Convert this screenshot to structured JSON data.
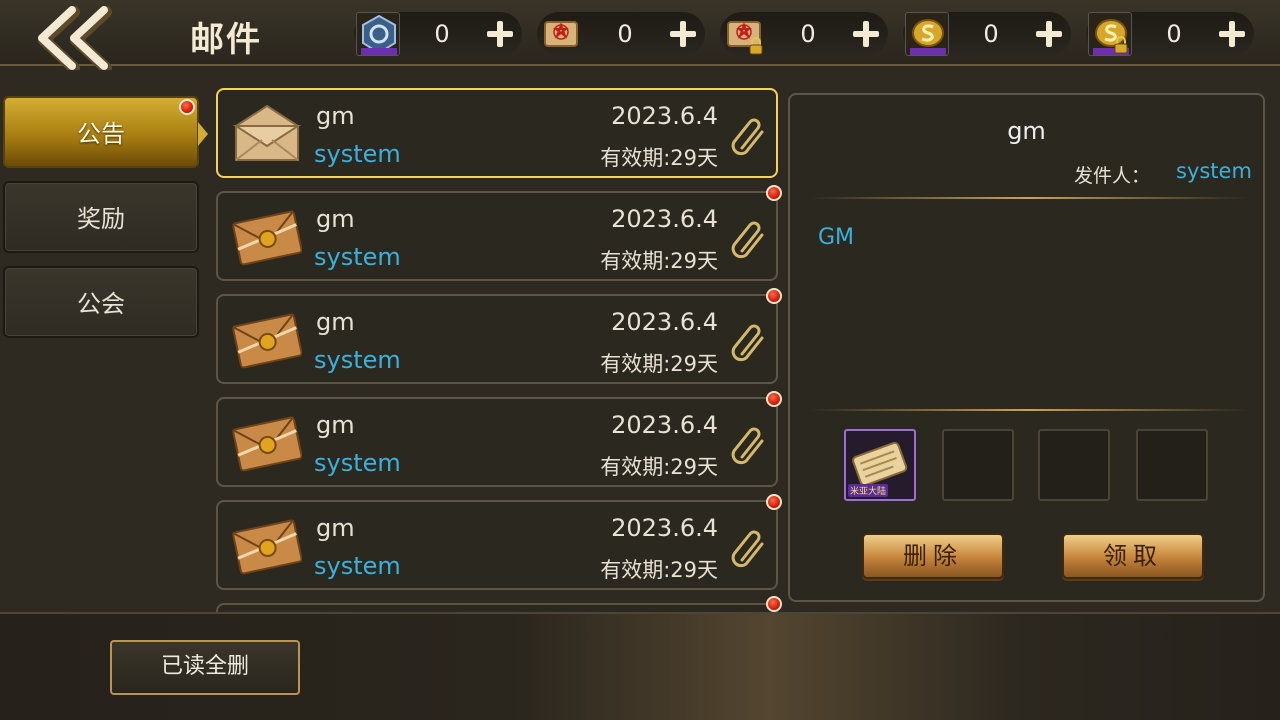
{
  "header": {
    "title": "邮件",
    "currencies": [
      {
        "name": "blue-emblem",
        "value": "0",
        "locked": false
      },
      {
        "name": "red-scroll",
        "value": "0",
        "locked": false
      },
      {
        "name": "red-scroll-locked",
        "value": "0",
        "locked": true
      },
      {
        "name": "gold-coin",
        "value": "0",
        "locked": false
      },
      {
        "name": "gold-coin-locked",
        "value": "0",
        "locked": true
      }
    ]
  },
  "tabs": [
    {
      "label": "公告",
      "active": true,
      "has_dot": true
    },
    {
      "label": "奖励",
      "active": false,
      "has_dot": false
    },
    {
      "label": "公会",
      "active": false,
      "has_dot": false
    }
  ],
  "mails": [
    {
      "subject": "gm",
      "sender": "system",
      "date": "2023.6.4",
      "expire": "有效期:29天",
      "read": true,
      "selected": true
    },
    {
      "subject": "gm",
      "sender": "system",
      "date": "2023.6.4",
      "expire": "有效期:29天",
      "read": false,
      "selected": false
    },
    {
      "subject": "gm",
      "sender": "system",
      "date": "2023.6.4",
      "expire": "有效期:29天",
      "read": false,
      "selected": false
    },
    {
      "subject": "gm",
      "sender": "system",
      "date": "2023.6.4",
      "expire": "有效期:29天",
      "read": false,
      "selected": false
    },
    {
      "subject": "gm",
      "sender": "system",
      "date": "2023.6.4",
      "expire": "有效期:29天",
      "read": false,
      "selected": false
    },
    {
      "subject": "",
      "sender": "",
      "date": "",
      "expire": "",
      "read": false,
      "selected": false
    }
  ],
  "detail": {
    "title": "gm",
    "sender_label": "发件人：",
    "sender_value": "system",
    "body": "GM",
    "attachment_label": "米亚大陆",
    "delete_label": "删除",
    "claim_label": "领取"
  },
  "footer": {
    "delete_read_label": "已读全删"
  },
  "colors": {
    "accent_blue": "#3ab1dc",
    "gold": "#d3ad33",
    "selected_border": "#f3d35b",
    "unread_dot": "#d41d0c"
  }
}
